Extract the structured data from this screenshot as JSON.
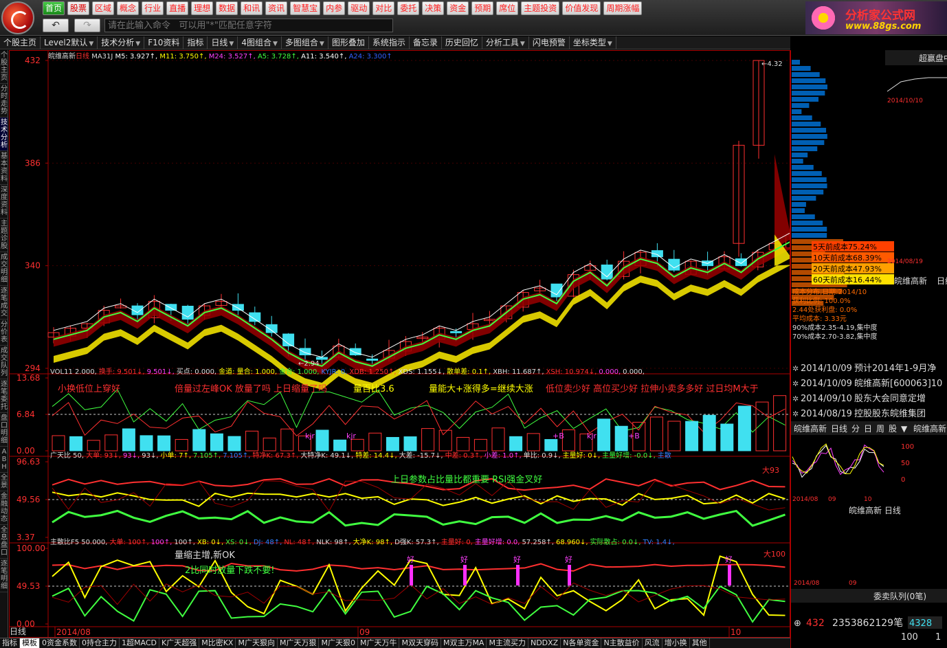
{
  "toolbar": {
    "nav_buttons": [
      "首页",
      "股票",
      "区域",
      "概念",
      "行业",
      "直播",
      "理想",
      "数据",
      "和讯",
      "资讯",
      "智慧宝",
      "内参",
      "驱动",
      "对比",
      "委托",
      "决策",
      "资金",
      "预期",
      "席位",
      "主题投资",
      "价值发现",
      "周期涨幅"
    ],
    "back_label": "↶",
    "forward_label": "↷",
    "command_placeholder": "请在此输入命令   可以用\"*\"匹配任意字符",
    "brand_title": "分析家公式网",
    "brand_url": "www.88gs.com"
  },
  "menu": {
    "items": [
      {
        "label": "个股主页",
        "dropdown": false
      },
      {
        "label": "Level2默认",
        "dropdown": true
      },
      {
        "label": "技术分析",
        "dropdown": true
      },
      {
        "label": "F10资料",
        "dropdown": false
      },
      {
        "label": "指标",
        "dropdown": false
      },
      {
        "label": "日线",
        "dropdown": true
      },
      {
        "label": "4图组合",
        "dropdown": true
      },
      {
        "label": "多图组合",
        "dropdown": true
      },
      {
        "label": "图形叠加",
        "dropdown": false
      },
      {
        "label": "系统指示",
        "dropdown": false
      },
      {
        "label": "备忘录",
        "dropdown": false
      },
      {
        "label": "历史回忆",
        "dropdown": false
      },
      {
        "label": "分析工具",
        "dropdown": true
      },
      {
        "label": "闪电预警",
        "dropdown": false
      },
      {
        "label": "坐标类型",
        "dropdown": true
      }
    ]
  },
  "left_tabs": [
    "个股主页",
    "分时走势",
    "技术分析",
    "基本资料",
    "深度资料",
    "主题诊股",
    "成交明细",
    "逐笔成交",
    "分价表",
    "成交队列",
    "逐笔委托",
    "盘口明细",
    "ABH",
    "全景",
    "金融动态",
    "全息盘口",
    "逐笔明细"
  ],
  "main_chart": {
    "stock": "皖维高新",
    "period": "日线",
    "legend": {
      "ma31j": "MA31J",
      "m5": "M5: 3.927↑",
      "m11": "M11: 3.750↑",
      "m24": "M24: 3.527↑",
      "a5": "A5: 3.728↑",
      "a11": "A11: 3.540↑",
      "a24": "A24: 3.300↑"
    },
    "y_ticks": [
      "432",
      "386",
      "340",
      "294"
    ],
    "high_label": "←4.32",
    "low_label": "←2.94",
    "colors": {
      "up": "#ff3030",
      "down": "#40e0f0",
      "ma5": "#ffffff",
      "ma11": "#ffff00",
      "ma24": "#ff00ff"
    }
  },
  "cost_distribution": {
    "rows": [
      {
        "label": "5天前成本75.24%",
        "color": "#ff4000"
      },
      {
        "label": "10天前成本68.39%",
        "color": "#ff5a00"
      },
      {
        "label": "20天前成本47.93%",
        "color": "#ffa000"
      },
      {
        "label": "60天前成本16.44%",
        "color": "#ffe000"
      }
    ],
    "info_rows": [
      "成本分布,日期:2014/10",
      "获利比例: 100.0%",
      "2.44处获利盘: 0.0%",
      "平均成本: 3.33元",
      "90%成本2.35-4.19,集中度",
      "70%成本2.70-3.82,集中度"
    ]
  },
  "vol_panel": {
    "legend": [
      "VOL11 2.000,",
      "换手: 9.501↓,",
      "9.501↓,",
      "买点: 0.000,",
      "金道: 量合: 1.000,",
      "金合: 1.000,",
      "KYJR: 0,",
      "XDB: 1.250↑,",
      "XDS: 1.155↓,",
      "散单差: 0.1↑,",
      "XBH: 11.687↑,",
      "XSH: 10.974↓,",
      "0.000,",
      "0.000,"
    ],
    "notes": [
      "小换低位上穿好",
      "倍量过左峰OK 放量了吗 上日缩量了吗",
      "量百比3.6",
      "量能大+涨得多=继续大涨",
      "低位卖少好 高位买少好 拉伸小卖多多好 过日均M大于"
    ],
    "y_ticks": [
      "13.68",
      "6.84",
      "0.00"
    ],
    "marks": [
      "kjr",
      "kjr",
      "+B",
      "kjr",
      "+B"
    ]
  },
  "panel3": {
    "legend": [
      "广天比 50,",
      "大单: 93↓,",
      "93↓,",
      "93↓,",
      "小单: 7↑,",
      "7.105↑,",
      "7.105↑,",
      "特净K: 67.3↑,",
      "大特净K: 49.1↓,",
      "特差: 14.4↓,",
      "大差: -15.7↓,",
      "中差: 0.3↑,",
      "小差: 1.0↑,",
      "单比: 0.9↓,",
      "主量好: 0↓,",
      "主量好增: -0.0↓,",
      "主散"
    ],
    "note": "上日参数占比量比都重要 RSI强金叉好",
    "tag": "大93",
    "y_ticks": [
      "96.63",
      "49.56",
      "3.37"
    ]
  },
  "panel4": {
    "legend": [
      "主散比F5 50.000,",
      "大单: 100↑,",
      "100↑,",
      "100↑,",
      "XB: 0↓,",
      "XS: 0↓,",
      "DJ: 48↑,",
      "NL: 48↑,",
      "NLK: 98↑,",
      "大净K: 98↑,",
      "D强K: 57.3↑,",
      "主量好: 0,",
      "主量好增: 0.0,",
      "57.258↑,",
      "68.960↓,",
      "实际散占: 0.0↓,",
      "TV: 1.4↓,"
    ],
    "notes": [
      "量缩主增,新OK",
      "2比同时放量下跌不要!"
    ],
    "tag": "大100",
    "good_label": "好",
    "y_ticks": [
      "100.00",
      "49.53",
      "0.00"
    ]
  },
  "time_axis": {
    "labels": [
      "2014/08",
      "09",
      "10"
    ],
    "period_label": "日线"
  },
  "right_panel": {
    "index_title": "超赢盘中",
    "mini_date_1": "2014/10/10",
    "mini_date_2": "2014/08/19",
    "mini_stock": "皖维高新",
    "mini_period": "日线",
    "news": [
      {
        "date": "2014/10/09",
        "text": "预计2014年1-9月净"
      },
      {
        "date": "2014/10/09",
        "text": "皖维高新[600063]10"
      },
      {
        "date": "2014/09/10",
        "text": "股东大会同意定增"
      },
      {
        "date": "2014/08/19",
        "text": "控股股东皖维集团"
      }
    ],
    "tabs_row": [
      "皖维高新",
      "日线",
      "分",
      "日",
      "周",
      "股",
      "▼",
      "皖维高新"
    ],
    "mini_chart_dates": [
      "2014/08",
      "09",
      "10"
    ],
    "mini_y": [
      "100",
      "50",
      "0"
    ],
    "mini2_title": "皖维高新  日线",
    "mini2_dates": [
      "2014/08",
      "09"
    ],
    "queue_title": "委卖队列(0笔)",
    "price": "432",
    "volume_text": "2353862129笔",
    "arrow_value": "4328",
    "bottom_left": "100",
    "bottom_right": "1"
  },
  "bottom_tabs": [
    "指标",
    "模板",
    "0资金系数",
    "0持仓主力",
    "1超MACD",
    "K广天超强",
    "M比密KX",
    "M广天狠向",
    "M广天万狠",
    "M广天狠0",
    "M广天万牛",
    "M双天穿码",
    "M双主万MA",
    "M主流买力",
    "NDDXZ",
    "N各单资金",
    "N主散益价",
    "风流",
    "增小换",
    "其他"
  ]
}
